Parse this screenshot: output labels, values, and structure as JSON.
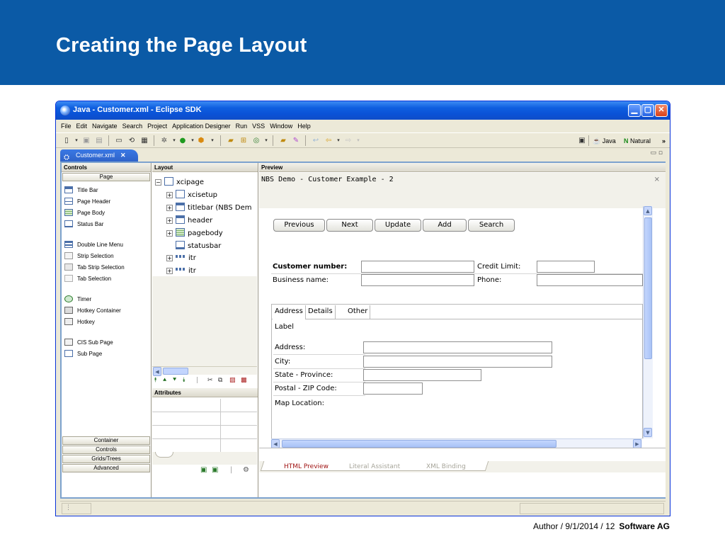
{
  "slide": {
    "title": "Creating the Page Layout",
    "footer_meta": "Author / 9/1/2014 / 12",
    "footer_brand": "Software AG"
  },
  "colors": {
    "slide_header": "#0b5aa6",
    "titlebar": "#0a52d6",
    "window_face": "#ece9d8",
    "active_tab_text": "#a01414"
  },
  "window": {
    "title": "Java - Customer.xml - Eclipse SDK",
    "controls": [
      "minimize-icon",
      "maximize-icon",
      "close-icon"
    ]
  },
  "menu": [
    "File",
    "Edit",
    "Navigate",
    "Search",
    "Project",
    "Application Designer",
    "Run",
    "VSS",
    "Window",
    "Help"
  ],
  "perspectives": {
    "java": "Java",
    "natural": "Natural",
    "more": "»"
  },
  "editor_tab": {
    "label": "Customer.xml",
    "close": "✕"
  },
  "controls_panel": {
    "header": "Controls",
    "page_label": "Page",
    "items": [
      "Title Bar",
      "Page Header",
      "Page Body",
      "Status Bar",
      "Double Line Menu",
      "Strip Selection",
      "Tab Strip Selection",
      "Tab Selection",
      "Timer",
      "Hotkey Container",
      "Hotkey",
      "CIS Sub Page",
      "Sub Page"
    ],
    "categories": [
      "Container",
      "Controls",
      "Grids/Trees",
      "Advanced"
    ]
  },
  "layout_panel": {
    "header": "Layout",
    "tree": [
      {
        "label": "xcipage",
        "expander": "−"
      },
      {
        "label": "xcisetup",
        "expander": "+"
      },
      {
        "label": "titlebar (NBS Dem",
        "expander": "+"
      },
      {
        "label": "header",
        "expander": "+"
      },
      {
        "label": "pagebody",
        "expander": "+"
      },
      {
        "label": "statusbar",
        "expander": ""
      },
      {
        "label": "itr",
        "expander": "+"
      },
      {
        "label": "itr",
        "expander": "+"
      }
    ],
    "attributes_header": "Attributes"
  },
  "preview": {
    "header": "Preview",
    "title": "NBS Demo - Customer Example - 2",
    "close": "⨯",
    "buttons": [
      "Previous",
      "Next",
      "Update",
      "Add",
      "Search"
    ],
    "customer_number_label": "Customer number:",
    "credit_limit_label": "Credit Limit:",
    "business_name_label": "Business name:",
    "phone_label": "Phone:",
    "tabs": [
      "Address",
      "Details",
      "Other"
    ],
    "section_label": "Label",
    "address_label": "Address:",
    "city_label": "City:",
    "state_label": "State - Province:",
    "postal_label": "Postal - ZIP Code:",
    "map_label": "Map Location:",
    "bottom_tabs": [
      "HTML Preview",
      "Literal Assistant",
      "XML Binding"
    ]
  }
}
